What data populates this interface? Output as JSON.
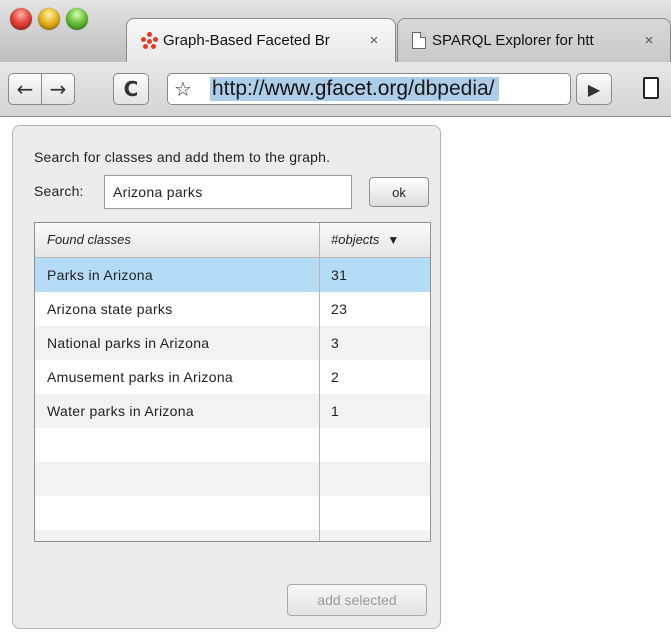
{
  "browser": {
    "tabs": [
      {
        "title": "Graph-Based Faceted Br",
        "active": true,
        "icon": "gfacet-favicon-icon"
      },
      {
        "title": "SPARQL Explorer for htt",
        "active": false,
        "icon": "page-icon"
      }
    ],
    "close_glyph": "×",
    "address_bar": {
      "url_prefix": "http://",
      "url_host": "www.gfacet.org",
      "url_path": "/dbpedia/"
    },
    "buttons": {
      "back": "←",
      "forward": "→",
      "reload": "C",
      "star": "☆",
      "go": "▶"
    }
  },
  "dialog": {
    "instructions": "Search for classes and add them to the graph.",
    "search_label": "Search:",
    "search_value": "Arizona parks",
    "ok_label": "ok",
    "table": {
      "columns": [
        "Found classes",
        "#objects"
      ],
      "sort_indicator": "▼",
      "rows": [
        {
          "name": "Parks in Arizona",
          "count": "31",
          "selected": true
        },
        {
          "name": "Arizona state parks",
          "count": "23",
          "selected": false
        },
        {
          "name": "National parks in Arizona",
          "count": "3",
          "selected": false
        },
        {
          "name": "Amusement parks in Arizona",
          "count": "2",
          "selected": false
        },
        {
          "name": "Water parks in Arizona",
          "count": "1",
          "selected": false
        }
      ]
    },
    "add_selected_label": "add selected"
  },
  "colors": {
    "selection": "#b4dcf7",
    "url_highlight": "#aecde9"
  }
}
